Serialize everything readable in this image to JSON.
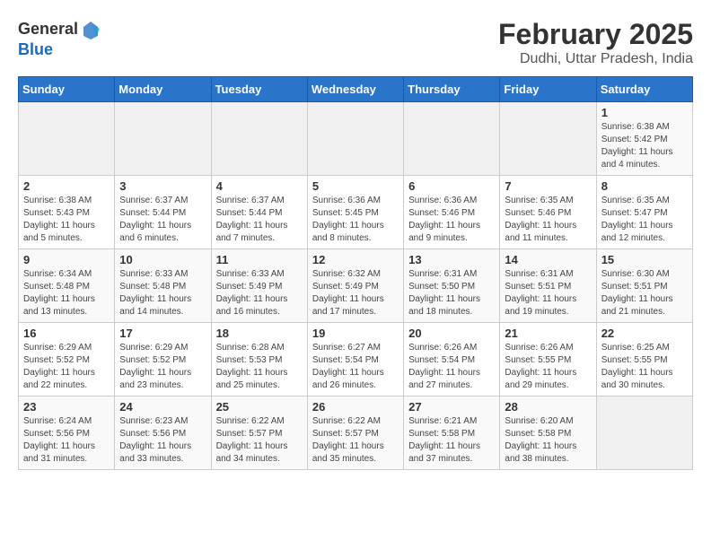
{
  "logo": {
    "general": "General",
    "blue": "Blue"
  },
  "title": "February 2025",
  "subtitle": "Dudhi, Uttar Pradesh, India",
  "days_of_week": [
    "Sunday",
    "Monday",
    "Tuesday",
    "Wednesday",
    "Thursday",
    "Friday",
    "Saturday"
  ],
  "weeks": [
    [
      {
        "day": "",
        "info": ""
      },
      {
        "day": "",
        "info": ""
      },
      {
        "day": "",
        "info": ""
      },
      {
        "day": "",
        "info": ""
      },
      {
        "day": "",
        "info": ""
      },
      {
        "day": "",
        "info": ""
      },
      {
        "day": "1",
        "info": "Sunrise: 6:38 AM\nSunset: 5:42 PM\nDaylight: 11 hours and 4 minutes."
      }
    ],
    [
      {
        "day": "2",
        "info": "Sunrise: 6:38 AM\nSunset: 5:43 PM\nDaylight: 11 hours and 5 minutes."
      },
      {
        "day": "3",
        "info": "Sunrise: 6:37 AM\nSunset: 5:44 PM\nDaylight: 11 hours and 6 minutes."
      },
      {
        "day": "4",
        "info": "Sunrise: 6:37 AM\nSunset: 5:44 PM\nDaylight: 11 hours and 7 minutes."
      },
      {
        "day": "5",
        "info": "Sunrise: 6:36 AM\nSunset: 5:45 PM\nDaylight: 11 hours and 8 minutes."
      },
      {
        "day": "6",
        "info": "Sunrise: 6:36 AM\nSunset: 5:46 PM\nDaylight: 11 hours and 9 minutes."
      },
      {
        "day": "7",
        "info": "Sunrise: 6:35 AM\nSunset: 5:46 PM\nDaylight: 11 hours and 11 minutes."
      },
      {
        "day": "8",
        "info": "Sunrise: 6:35 AM\nSunset: 5:47 PM\nDaylight: 11 hours and 12 minutes."
      }
    ],
    [
      {
        "day": "9",
        "info": "Sunrise: 6:34 AM\nSunset: 5:48 PM\nDaylight: 11 hours and 13 minutes."
      },
      {
        "day": "10",
        "info": "Sunrise: 6:33 AM\nSunset: 5:48 PM\nDaylight: 11 hours and 14 minutes."
      },
      {
        "day": "11",
        "info": "Sunrise: 6:33 AM\nSunset: 5:49 PM\nDaylight: 11 hours and 16 minutes."
      },
      {
        "day": "12",
        "info": "Sunrise: 6:32 AM\nSunset: 5:49 PM\nDaylight: 11 hours and 17 minutes."
      },
      {
        "day": "13",
        "info": "Sunrise: 6:31 AM\nSunset: 5:50 PM\nDaylight: 11 hours and 18 minutes."
      },
      {
        "day": "14",
        "info": "Sunrise: 6:31 AM\nSunset: 5:51 PM\nDaylight: 11 hours and 19 minutes."
      },
      {
        "day": "15",
        "info": "Sunrise: 6:30 AM\nSunset: 5:51 PM\nDaylight: 11 hours and 21 minutes."
      }
    ],
    [
      {
        "day": "16",
        "info": "Sunrise: 6:29 AM\nSunset: 5:52 PM\nDaylight: 11 hours and 22 minutes."
      },
      {
        "day": "17",
        "info": "Sunrise: 6:29 AM\nSunset: 5:52 PM\nDaylight: 11 hours and 23 minutes."
      },
      {
        "day": "18",
        "info": "Sunrise: 6:28 AM\nSunset: 5:53 PM\nDaylight: 11 hours and 25 minutes."
      },
      {
        "day": "19",
        "info": "Sunrise: 6:27 AM\nSunset: 5:54 PM\nDaylight: 11 hours and 26 minutes."
      },
      {
        "day": "20",
        "info": "Sunrise: 6:26 AM\nSunset: 5:54 PM\nDaylight: 11 hours and 27 minutes."
      },
      {
        "day": "21",
        "info": "Sunrise: 6:26 AM\nSunset: 5:55 PM\nDaylight: 11 hours and 29 minutes."
      },
      {
        "day": "22",
        "info": "Sunrise: 6:25 AM\nSunset: 5:55 PM\nDaylight: 11 hours and 30 minutes."
      }
    ],
    [
      {
        "day": "23",
        "info": "Sunrise: 6:24 AM\nSunset: 5:56 PM\nDaylight: 11 hours and 31 minutes."
      },
      {
        "day": "24",
        "info": "Sunrise: 6:23 AM\nSunset: 5:56 PM\nDaylight: 11 hours and 33 minutes."
      },
      {
        "day": "25",
        "info": "Sunrise: 6:22 AM\nSunset: 5:57 PM\nDaylight: 11 hours and 34 minutes."
      },
      {
        "day": "26",
        "info": "Sunrise: 6:22 AM\nSunset: 5:57 PM\nDaylight: 11 hours and 35 minutes."
      },
      {
        "day": "27",
        "info": "Sunrise: 6:21 AM\nSunset: 5:58 PM\nDaylight: 11 hours and 37 minutes."
      },
      {
        "day": "28",
        "info": "Sunrise: 6:20 AM\nSunset: 5:58 PM\nDaylight: 11 hours and 38 minutes."
      },
      {
        "day": "",
        "info": ""
      }
    ]
  ]
}
